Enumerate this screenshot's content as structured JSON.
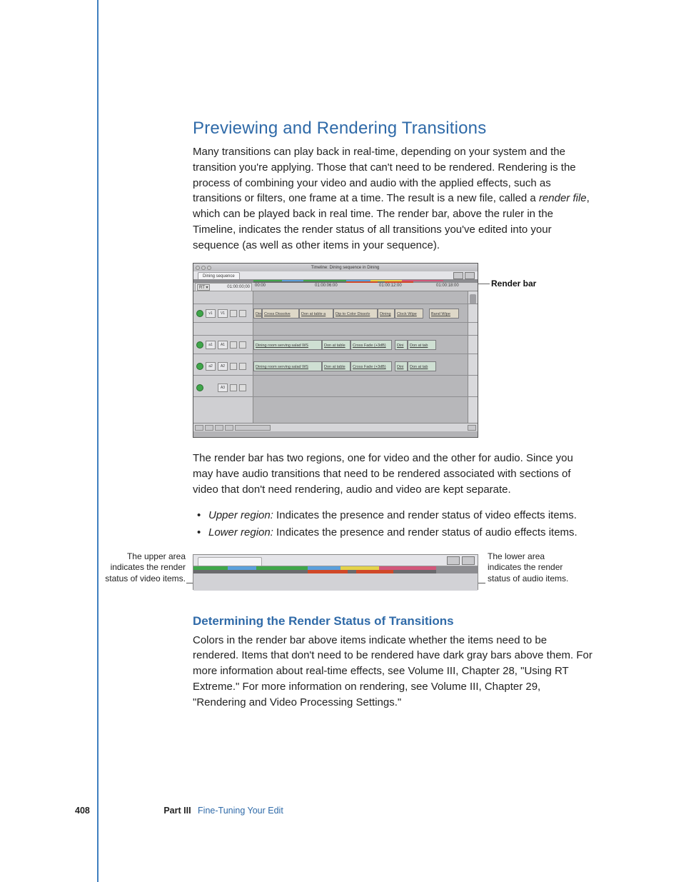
{
  "headings": {
    "h1": "Previewing and Rendering Transitions",
    "h2": "Determining the Render Status of Transitions"
  },
  "paragraphs": {
    "p1a": "Many transitions can play back in real-time, depending on your system and the transition you're applying. Those that can't need to be rendered. Rendering is the process of combining your video and audio with the applied effects, such as transitions or filters, one frame at a time. The result is a new file, called a ",
    "p1_em": "render file",
    "p1b": ", which can be played back in real time. The render bar, above the ruler in the Timeline, indicates the render status of all transitions you've edited into your sequence (as well as other items in your sequence).",
    "p2": "The render bar has two regions, one for video and the other for audio. Since you may have audio transitions that need to be rendered associated with sections of video that don't need rendering, audio and video are kept separate.",
    "p3": "Colors in the render bar above items indicate whether the items need to be rendered. Items that don't need to be rendered have dark gray bars above them. For more information about real-time effects, see Volume III, Chapter 28, \"Using RT Extreme.\" For more information on rendering, see Volume III, Chapter 29, \"Rendering and Video Processing Settings.\""
  },
  "bullets": {
    "b1_em": "Upper region:",
    "b1_txt": "  Indicates the presence and render status of video effects items.",
    "b2_em": "Lower region:",
    "b2_txt": "  Indicates the presence and render status of audio effects items."
  },
  "annotations": {
    "render_bar": "Render bar",
    "upper_left": "The upper area indicates the render status of video items.",
    "lower_right": "The lower area indicates the render status of audio items."
  },
  "timeline": {
    "window_title": "Timeline: Dining sequence in Dining",
    "tab": "Dining sequence",
    "rt_button": "RT ▾",
    "timecode": "01:00:00;00",
    "ruler": {
      "t0": "00:00",
      "t1": "01:00:06:00",
      "t2": "01:00:12:00",
      "t3": "01:00:18:00"
    },
    "tracks": {
      "v1_src": "v1",
      "v1_dst": "V1",
      "a1_src": "a1",
      "a1_dst": "A1",
      "a2_src": "a2",
      "a2_dst": "A2",
      "a3_dst": "A3"
    },
    "clips": {
      "v_seg1": "Din",
      "v_cross_dissolve": "Cross Dissolve",
      "v_don_table": "Don at table a",
      "v_dip_color": "Dip to Color Dissolv",
      "v_dining": "Dining",
      "v_clock_wipe": "Clock Wipe",
      "v_band_wipe": "Band Wipe",
      "a_dining_ws": "Dining room serving salad WS",
      "a_don_table": "Don at table",
      "a_cross_fade": "Cross Fade (+3dB)",
      "a_dini": "Dini",
      "a_don_tab": "Don at tab"
    }
  },
  "footer": {
    "page": "408",
    "part": "Part III",
    "chapter": "Fine-Tuning Your Edit"
  }
}
